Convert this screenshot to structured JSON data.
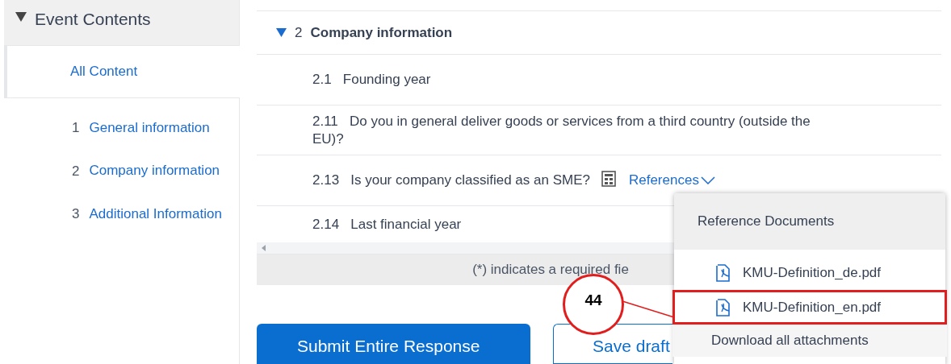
{
  "sidebar": {
    "header": {
      "label": "Event Contents",
      "expanded": true
    },
    "items": [
      {
        "label": "All Content",
        "selected": true
      },
      {
        "number": "1",
        "label": "General information",
        "selected": false
      },
      {
        "number": "2",
        "label": "Company information",
        "selected": false
      },
      {
        "number": "3",
        "label": "Additional Information",
        "selected": false
      }
    ]
  },
  "section": {
    "number": "2",
    "title": "Company information",
    "expanded": true
  },
  "questions": [
    {
      "number": "2.1",
      "text": "Founding year"
    },
    {
      "number": "2.11",
      "text": "Do you in general deliver goods or services from a third country (outside the EU)?"
    },
    {
      "number": "2.13",
      "text": "Is your company classified as an SME?",
      "references_label": "References"
    },
    {
      "number": "2.14",
      "text": "Last financial year"
    }
  ],
  "footer_note": "(*) indicates a required fie",
  "buttons": [
    {
      "label": "Submit Entire Response",
      "kind": "primary"
    },
    {
      "label": "Save draft",
      "kind": "secondary"
    }
  ],
  "popup": {
    "title": "Reference Documents",
    "items": [
      {
        "kind": "file",
        "label": "KMU-Definition_de.pdf",
        "highlighted": false
      },
      {
        "kind": "file",
        "label": "KMU-Definition_en.pdf",
        "highlighted": true
      },
      {
        "kind": "action",
        "label": "Download all attachments",
        "highlighted": false
      }
    ]
  },
  "annotation": {
    "label": "44"
  }
}
